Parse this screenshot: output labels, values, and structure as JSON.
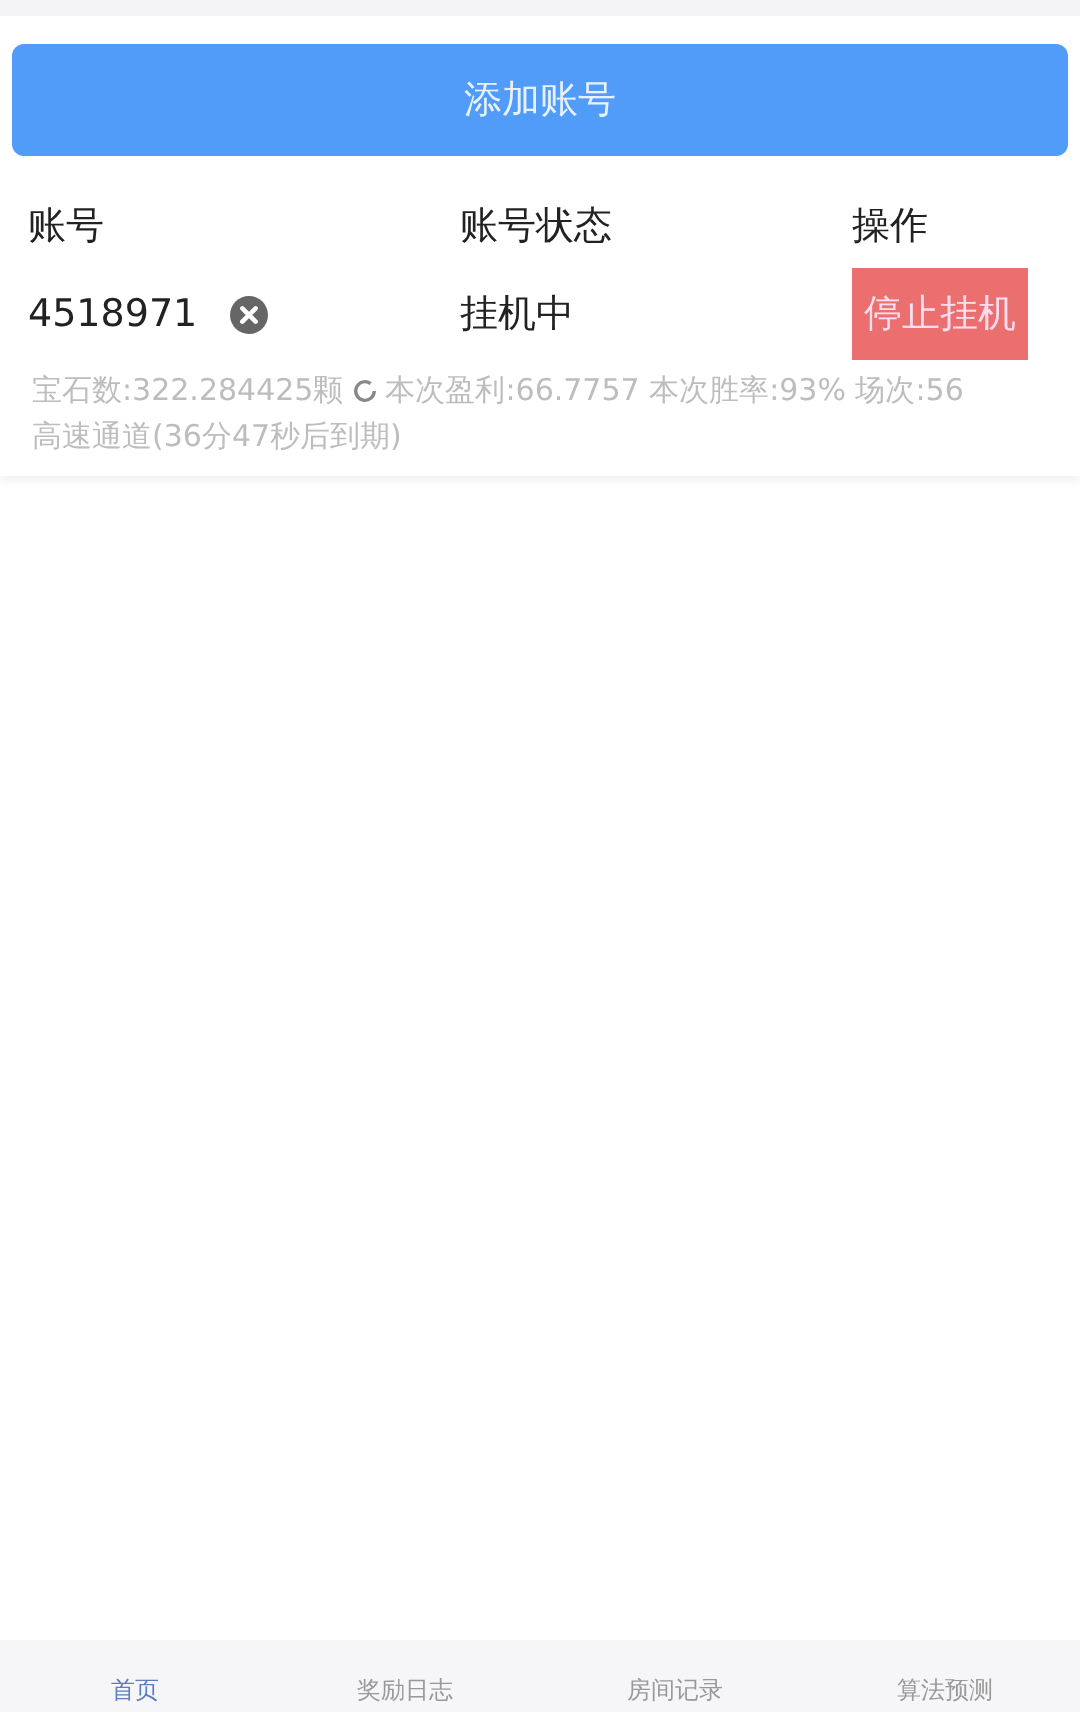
{
  "add_button": "添加账号",
  "table": {
    "columns": [
      "账号",
      "账号状态",
      "操作"
    ],
    "rows": [
      {
        "account": "4518971",
        "status": "挂机中",
        "action": "停止挂机",
        "gems": "宝石数:322.284425颗",
        "stats": "本次盈利:66.7757 本次胜率:93% 场次:56",
        "channel": "高速通道(36分47秒后到期)"
      }
    ]
  },
  "tab_bar": [
    {
      "label": "首页",
      "selected": true
    },
    {
      "label": "奖励日志",
      "selected": false
    },
    {
      "label": "房间记录",
      "selected": false
    },
    {
      "label": "算法预测",
      "selected": false
    }
  ]
}
